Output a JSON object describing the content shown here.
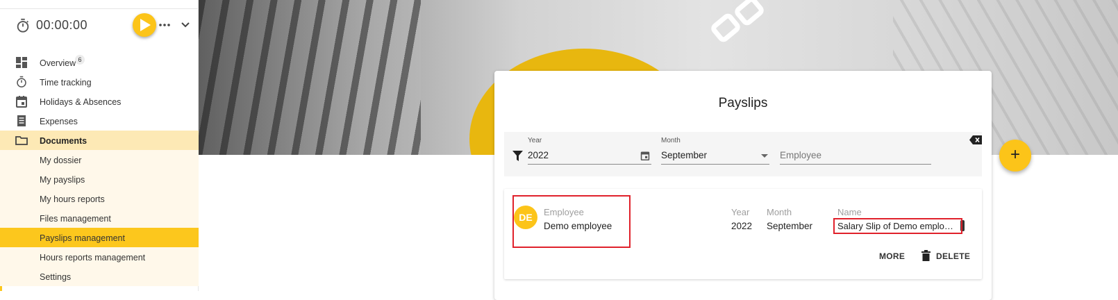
{
  "timer": {
    "time": "00:00:00"
  },
  "nav": {
    "overview": {
      "label": "Overview",
      "badge": "6"
    },
    "time_tracking": {
      "label": "Time tracking"
    },
    "holidays": {
      "label": "Holidays & Absences"
    },
    "expenses": {
      "label": "Expenses"
    },
    "documents": {
      "label": "Documents"
    },
    "sub_items": [
      {
        "label": "My dossier"
      },
      {
        "label": "My payslips"
      },
      {
        "label": "My hours reports"
      },
      {
        "label": "Files management"
      },
      {
        "label": "Payslips management"
      },
      {
        "label": "Hours reports management"
      },
      {
        "label": "Settings"
      }
    ]
  },
  "card": {
    "title": "Payslips",
    "filters": {
      "year": {
        "label": "Year",
        "value": "2022"
      },
      "month": {
        "label": "Month",
        "value": "September"
      },
      "employee": {
        "placeholder": "Employee"
      }
    },
    "row": {
      "initials": "DE",
      "employee_label": "Employee",
      "employee_value": "Demo employee",
      "year_label": "Year",
      "year_value": "2022",
      "month_label": "Month",
      "month_value": "September",
      "name_label": "Name",
      "name_value": "Salary Slip of Demo employee",
      "more_label": "MORE",
      "delete_label": "DELETE"
    }
  },
  "fab": {
    "symbol": "+"
  },
  "colors": {
    "accent": "#fcc419",
    "highlight": "#e0212b",
    "active_parent_bg": "#fde9b5",
    "sub_bg": "#fff8ea"
  },
  "icons": {
    "timer": "stopwatch-icon",
    "play": "play-icon",
    "more": "more-horizontal-icon",
    "expand": "chevron-down-icon",
    "overview": "dashboard-icon",
    "time_tracking": "stopwatch-icon",
    "holidays": "calendar-icon",
    "expenses": "receipt-icon",
    "documents": "folder-icon",
    "filter": "filter-icon",
    "calendar": "calendar-icon",
    "clear": "backspace-icon",
    "delete": "trash-icon",
    "fab": "plus-icon",
    "hero": "link-icon"
  }
}
